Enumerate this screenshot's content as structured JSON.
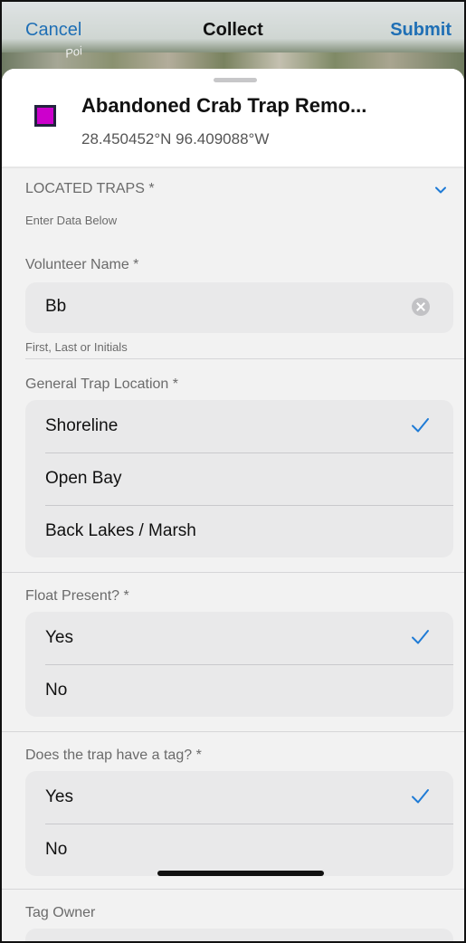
{
  "nav": {
    "cancel": "Cancel",
    "title": "Collect",
    "submit": "Submit",
    "map_label": "Poi"
  },
  "header": {
    "layer_title": "Abandoned Crab Trap Remo...",
    "coordinates": "28.450452°N 96.409088°W",
    "swatch_color": "#cc00cc"
  },
  "located": {
    "label": "LOCATED TRAPS *",
    "hint": "Enter Data Below"
  },
  "volunteer": {
    "label": "Volunteer Name *",
    "value": "Bb",
    "hint": "First, Last or Initials"
  },
  "location": {
    "label": "General Trap Location *",
    "options": [
      "Shoreline",
      "Open Bay",
      "Back Lakes / Marsh"
    ],
    "selected": "Shoreline"
  },
  "float": {
    "label": "Float Present? *",
    "options": [
      "Yes",
      "No"
    ],
    "selected": "Yes"
  },
  "tag": {
    "label": "Does the trap have a tag? *",
    "options": [
      "Yes",
      "No"
    ],
    "selected": "Yes"
  },
  "tag_owner": {
    "label": "Tag Owner"
  },
  "colors": {
    "accent": "#1f6fb5",
    "check": "#1f7bd6"
  }
}
